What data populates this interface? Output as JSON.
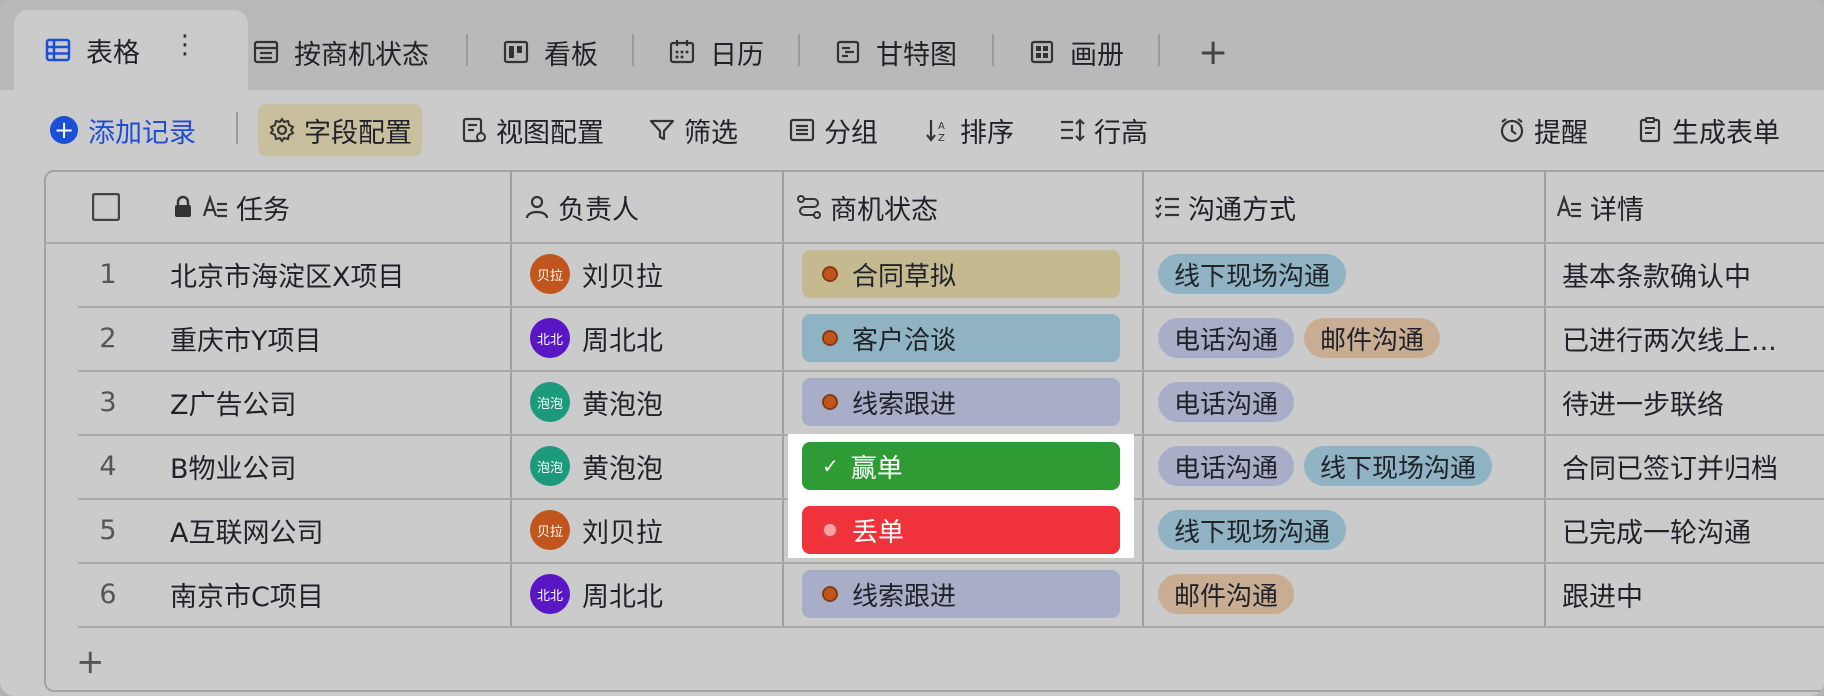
{
  "tabs": [
    {
      "label": "表格",
      "icon": "table-icon",
      "active": true
    },
    {
      "label": "按商机状态",
      "icon": "grouped-table-icon"
    },
    {
      "label": "看板",
      "icon": "kanban-icon"
    },
    {
      "label": "日历",
      "icon": "calendar-icon"
    },
    {
      "label": "甘特图",
      "icon": "gantt-icon"
    },
    {
      "label": "画册",
      "icon": "gallery-icon"
    }
  ],
  "add_tab_symbol": "+",
  "more_symbol": "⋮",
  "toolbar": {
    "add_record": "添加记录",
    "field_config": "字段配置",
    "view_config": "视图配置",
    "filter": "筛选",
    "group": "分组",
    "sort": "排序",
    "row_height": "行高",
    "reminder": "提醒",
    "generate_form": "生成表单"
  },
  "columns": {
    "task": "任务",
    "owner": "负责人",
    "status": "商机状态",
    "channel": "沟通方式",
    "detail": "详情"
  },
  "rows": [
    {
      "num": "1",
      "task": "北京市海淀区X项目",
      "owner": "刘贝拉",
      "avatar_text": "贝拉",
      "avatar_color": "#c0561d",
      "status": "合同草拟",
      "status_bg": "#c5b98f",
      "channels": [
        {
          "label": "线下现场沟通",
          "bg": "#8fb3c2"
        }
      ],
      "detail": "基本条款确认中"
    },
    {
      "num": "2",
      "task": "重庆市Y项目",
      "owner": "周北北",
      "avatar_text": "北北",
      "avatar_color": "#5a16c4",
      "status": "客户洽谈",
      "status_bg": "#8fb3c2",
      "channels": [
        {
          "label": "电话沟通",
          "bg": "#a9aec8"
        },
        {
          "label": "邮件沟通",
          "bg": "#c9ad92"
        }
      ],
      "detail": "已进行两次线上..."
    },
    {
      "num": "3",
      "task": "Z广告公司",
      "owner": "黄泡泡",
      "avatar_text": "泡泡",
      "avatar_color": "#1c9a7c",
      "status": "线索跟进",
      "status_bg": "#a9aec8",
      "channels": [
        {
          "label": "电话沟通",
          "bg": "#a9aec8"
        }
      ],
      "detail": "待进一步联络"
    },
    {
      "num": "4",
      "task": "B物业公司",
      "owner": "黄泡泡",
      "avatar_text": "泡泡",
      "avatar_color": "#1c9a7c",
      "status": "赢单",
      "status_bg": "#2e9b34",
      "status_check": "✓",
      "channels": [
        {
          "label": "电话沟通",
          "bg": "#a9aec8"
        },
        {
          "label": "线下现场沟通",
          "bg": "#8fb3c2"
        }
      ],
      "detail": "合同已签订并归档"
    },
    {
      "num": "5",
      "task": "A互联网公司",
      "owner": "刘贝拉",
      "avatar_text": "贝拉",
      "avatar_color": "#c0561d",
      "status": "丢单",
      "status_bg": "#f0323a",
      "channels": [
        {
          "label": "线下现场沟通",
          "bg": "#8fb3c2"
        }
      ],
      "detail": "已完成一轮沟通"
    },
    {
      "num": "6",
      "task": "南京市C项目",
      "owner": "周北北",
      "avatar_text": "北北",
      "avatar_color": "#5a16c4",
      "status": "线索跟进",
      "status_bg": "#a9aec8",
      "channels": [
        {
          "label": "邮件沟通",
          "bg": "#c9ad92"
        }
      ],
      "detail": "跟进中"
    }
  ],
  "add_row_symbol": "+"
}
